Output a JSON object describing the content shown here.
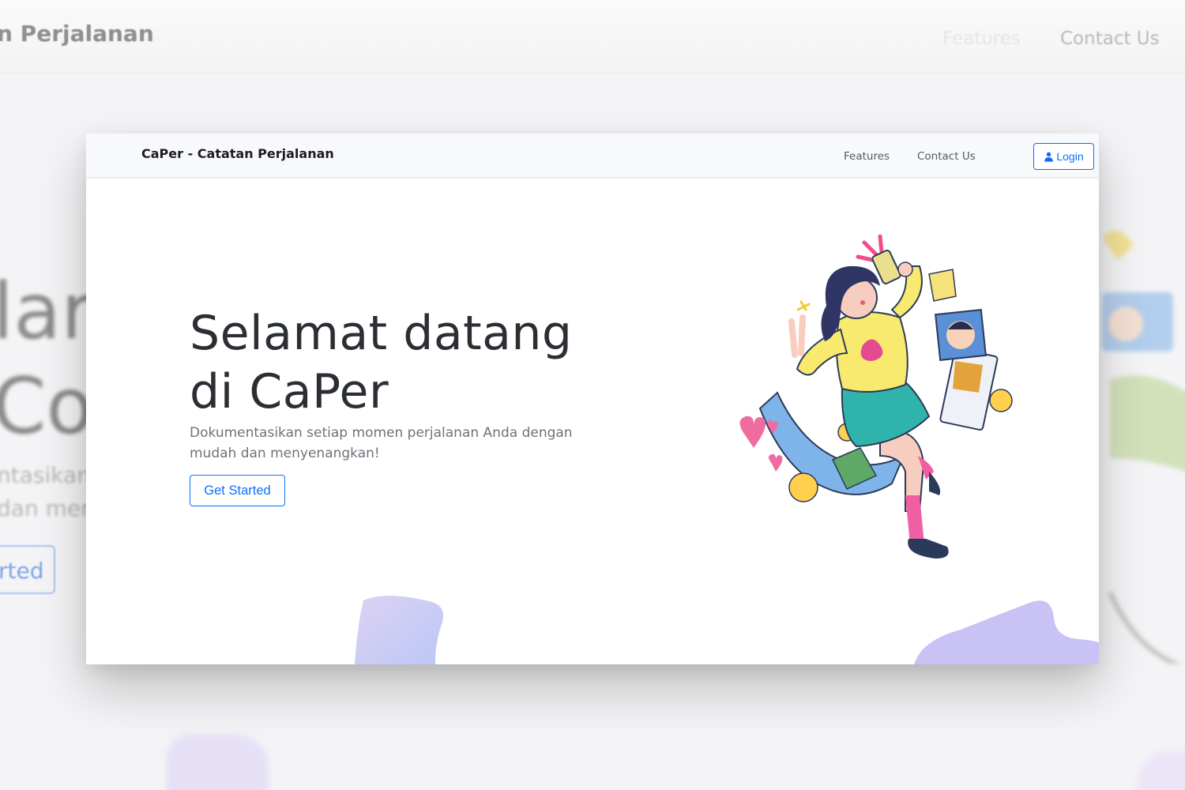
{
  "app": {
    "brand": "CaPer - Catatan Perjalanan"
  },
  "nav": {
    "features_label": "Features",
    "contact_label": "Contact Us",
    "login_label": "Login",
    "login_icon": "user-icon"
  },
  "hero": {
    "title_line1": "Selamat datang",
    "title_line2": "di CaPer",
    "subtitle": "Dokumentasikan setiap momen perjalanan Anda dengan mudah dan menyenangkan!",
    "cta_label": "Get Started",
    "illustration": "traveler-selfie-illustration"
  },
  "backdrop": {
    "brand_fragment": "n Perjalanan",
    "features_label": "Features",
    "contact_label": "Contact Us",
    "hero_fragment1": "lar",
    "hero_fragment2": "Co",
    "sub_fragment1": "ntasikan",
    "sub_fragment2": "dan mer",
    "cta_fragment": "rted"
  },
  "colors": {
    "primary": "#0d6efd",
    "text_dark": "#2b2f33",
    "text_muted": "#6c737a",
    "navbar_bg": "#f8f9fa",
    "blob": "#c9c3f5"
  }
}
